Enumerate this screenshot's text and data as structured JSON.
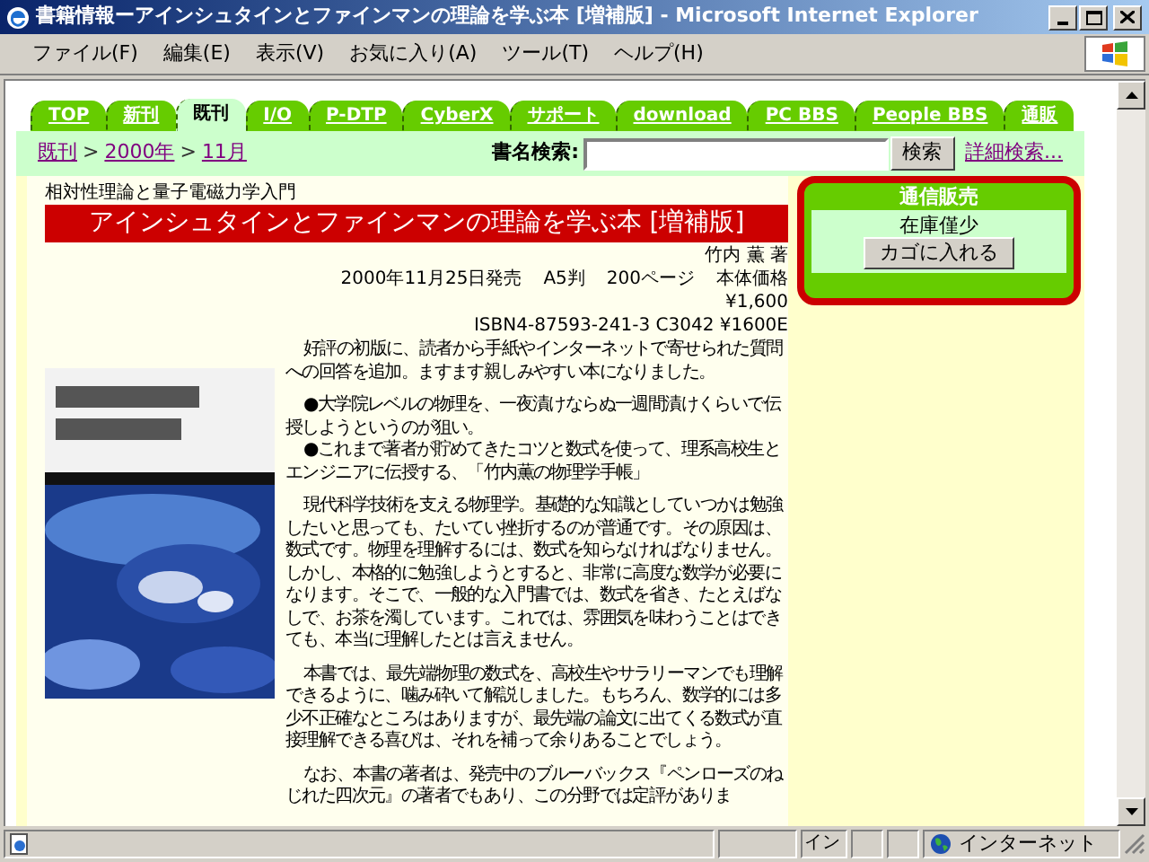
{
  "window": {
    "title": "書籍情報ーアインシュタインとファインマンの理論を学ぶ本 [増補版] - Microsoft Internet Explorer"
  },
  "menu": [
    "ファイル(F)",
    "編集(E)",
    "表示(V)",
    "お気に入り(A)",
    "ツール(T)",
    "ヘルプ(H)"
  ],
  "tabs": [
    {
      "label": "TOP",
      "selected": false
    },
    {
      "label": "新刊",
      "selected": false
    },
    {
      "label": "既刊",
      "selected": true
    },
    {
      "label": "I/O",
      "selected": false
    },
    {
      "label": "P-DTP",
      "selected": false
    },
    {
      "label": "CyberX",
      "selected": false
    },
    {
      "label": "サポート",
      "selected": false
    },
    {
      "label": "download",
      "selected": false
    },
    {
      "label": "PC BBS",
      "selected": false
    },
    {
      "label": "People BBS",
      "selected": false
    },
    {
      "label": "通販",
      "selected": false
    }
  ],
  "breadcrumb": [
    {
      "kind": "link",
      "text": "既刊"
    },
    {
      "kind": "separator",
      "text": ">"
    },
    {
      "kind": "link",
      "text": "2000年"
    },
    {
      "kind": "separator",
      "text": ">"
    },
    {
      "kind": "link",
      "text": "11月"
    }
  ],
  "search": {
    "label": "書名検索:",
    "button": "検索",
    "advanced_link": "詳細検索..."
  },
  "book": {
    "subtitle": "相対性理論と量子電磁力学入門",
    "title": "アインシュタインとファインマンの理論を学ぶ本 [増補版]",
    "author": "竹内 薫 著",
    "release_date": "2000年11月25日発売",
    "format": "A5判",
    "pages": "200ページ",
    "price_label": "本体価格",
    "price": "¥1,600",
    "isbn": "ISBN4-87593-241-3 C3042 ¥1600E",
    "paragraphs": [
      [
        "好評の初版に、読者から手紙やインターネットで寄せられた質問への回答を追加。ますます親しみやすい本になりました。"
      ],
      [
        "●大学院レベルの物理を、一夜漬けならぬ一週間漬けくらいで伝授しようというのが狙い。",
        "●これまで著者が貯めてきたコツと数式を使って、理系高校生とエンジニアに伝授する、「竹内薫の物理学手帳」"
      ],
      [
        "現代科学技術を支える物理学。基礎的な知識としていつかは勉強したいと思っても、たいてい挫折するのが普通です。その原因は、数式です。物理を理解するには、数式を知らなければなりません。しかし、本格的に勉強しようとすると、非常に高度な数学が必要になります。そこで、一般的な入門書では、数式を省き、たとえばなしで、お茶を濁しています。これでは、雰囲気を味わうことはできても、本当に理解したとは言えません。"
      ],
      [
        "本書では、最先端物理の数式を、高校生やサラリーマンでも理解できるように、噛み砕いて解説しました。もちろん、数学的には多少不正確なところはありますが、最先端の論文に出てくる数式が直接理解できる喜びは、それを補って余りあることでしょう。"
      ],
      [
        "なお、本書の著者は、発売中のブルーバックス『ペンローズのねじれた四次元』の著者でもあり、この分野では定評がありま"
      ]
    ]
  },
  "order_box": {
    "heading": "通信販売",
    "stock": "在庫僅少",
    "button": "カゴに入れる"
  },
  "status_bar": {
    "input_mode": "イン",
    "zone": "インターネット"
  }
}
